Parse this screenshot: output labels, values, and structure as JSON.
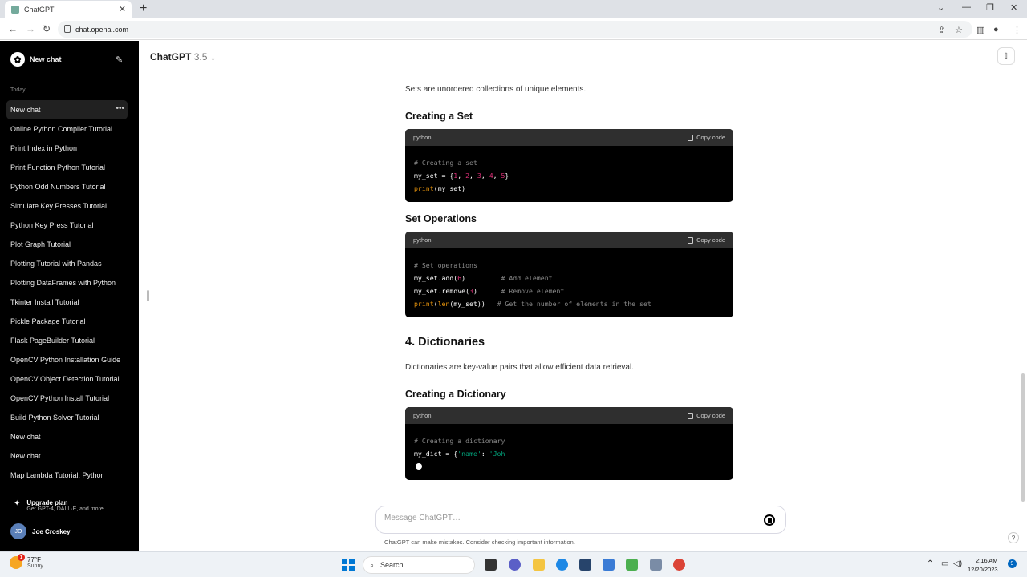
{
  "browser": {
    "tab_title": "ChatGPT",
    "url": "chat.openai.com"
  },
  "sidebar": {
    "new_chat_label": "New chat",
    "section_today": "Today",
    "items": [
      {
        "label": "New chat"
      },
      {
        "label": "Online Python Compiler Tutorial"
      },
      {
        "label": "Print Index in Python"
      },
      {
        "label": "Print Function Python Tutorial"
      },
      {
        "label": "Python Odd Numbers Tutorial"
      },
      {
        "label": "Simulate Key Presses Tutorial"
      },
      {
        "label": "Python Key Press Tutorial"
      },
      {
        "label": "Plot Graph Tutorial"
      },
      {
        "label": "Plotting Tutorial with Pandas"
      },
      {
        "label": "Plotting DataFrames with Python"
      },
      {
        "label": "Tkinter Install Tutorial"
      },
      {
        "label": "Pickle Package Tutorial"
      },
      {
        "label": "Flask PageBuilder Tutorial"
      },
      {
        "label": "OpenCV Python Installation Guide"
      },
      {
        "label": "OpenCV Object Detection Tutorial"
      },
      {
        "label": "OpenCV Python Install Tutorial"
      },
      {
        "label": "Build Python Solver Tutorial"
      },
      {
        "label": "New chat"
      },
      {
        "label": "New chat"
      },
      {
        "label": "Map Lambda Tutorial: Python"
      }
    ],
    "upgrade_title": "Upgrade plan",
    "upgrade_subtitle": "Get GPT-4, DALL·E, and more",
    "user_initials": "JO",
    "user_name": "Joe Croskey"
  },
  "header": {
    "model_name": "ChatGPT",
    "model_version": "3.5"
  },
  "content": {
    "intro": "Sets are unordered collections of unique elements.",
    "h_creating_set": "Creating a Set",
    "h_set_ops": "Set Operations",
    "h_dicts": "4. Dictionaries",
    "dict_para": "Dictionaries are key-value pairs that allow efficient data retrieval.",
    "h_creating_dict": "Creating a Dictionary",
    "code_lang": "python",
    "copy_label": "Copy code",
    "code1": {
      "comment": "# Creating a set",
      "l2_var": "my_set = {",
      "l2_n1": "1",
      "l2_n2": "2",
      "l2_n3": "3",
      "l2_n4": "4",
      "l2_n5": "5",
      "l2_sep": ", ",
      "l2_end": "}",
      "l3_fn": "print",
      "l3_arg": "(my_set)"
    },
    "code2": {
      "comment": "# Set operations",
      "l2_code": "my_set.add(",
      "l2_num": "6",
      "l2_close": ")",
      "l2_comment": "# Add element",
      "l3_code": "my_set.remove(",
      "l3_num": "3",
      "l3_close": ")",
      "l3_comment": "# Remove element",
      "l4_fn1": "print",
      "l4_open": "(",
      "l4_fn2": "len",
      "l4_arg": "(my_set))",
      "l4_comment": "# Get the number of elements in the set"
    },
    "code3": {
      "comment": "# Creating a dictionary",
      "l2_var": "my_dict = {",
      "l2_str1": "'name'",
      "l2_colon": ": ",
      "l2_str2": "'Joh"
    }
  },
  "composer": {
    "placeholder": "Message ChatGPT…",
    "disclaimer": "ChatGPT can make mistakes. Consider checking important information."
  },
  "taskbar": {
    "temperature": "77°F",
    "condition": "Sunny",
    "weather_badge": "1",
    "search_label": "Search",
    "time": "2:16 AM",
    "date": "12/20/2023",
    "notification_count": "9"
  }
}
